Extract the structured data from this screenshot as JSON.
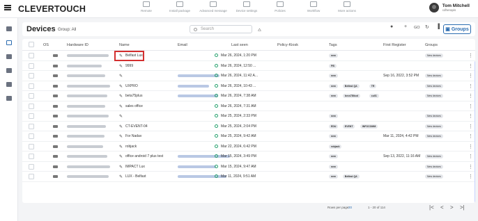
{
  "app": {
    "logo": "CLEVERTOUCH",
    "user_name": "Tom Mitchell",
    "user_org": "cdherapis"
  },
  "toolbar": [
    "Remote",
    "Install package",
    "Advanced message",
    "Device settings",
    "Policies",
    "Workflow",
    "More actions"
  ],
  "header": {
    "title": "Devices",
    "group": "Group: All",
    "search_placeholder": "Search",
    "groups_button": "Groups",
    "go": "GO"
  },
  "columns": {
    "os": "OS",
    "hardware_id": "Hardware ID",
    "name": "Name",
    "email": "Email",
    "last_seen": "Last seen",
    "policy_kiosk": "Policy-Kiosk",
    "tags": "Tags",
    "first_register": "First Register",
    "groups": "Groups"
  },
  "rows": [
    {
      "name": "Belfast Lux",
      "seen": "Mar 26, 2024, 1:20 PM",
      "tags": [
        "new"
      ],
      "first": "",
      "group": "New devices",
      "hw": 60,
      "em": 0
    },
    {
      "name": "9999",
      "seen": "Mar 26, 2024, 12:50 ...",
      "tags": [
        "PB"
      ],
      "first": "",
      "group": "",
      "hw": 50,
      "em": 0
    },
    {
      "name": "",
      "seen": "Mar 26, 2024, 11:42 A...",
      "tags": [
        "new"
      ],
      "first": "Sep 16, 2022, 3:52 PM",
      "group": "New devices",
      "hw": 55,
      "em": 60
    },
    {
      "name": "UXPRO",
      "seen": "Mar 26, 2024, 10:43 ...",
      "tags": [
        "new",
        "Belfast QA",
        "TR"
      ],
      "first": "",
      "group": "New devices",
      "hw": 62,
      "em": 45
    },
    {
      "name": "beta75plus",
      "seen": "Mar 26, 2024, 7:38 AM",
      "tags": [
        "new",
        "bvcs78lkod",
        "cull1"
      ],
      "first": "",
      "group": "New devices",
      "hw": 58,
      "em": 58
    },
    {
      "name": "sales office",
      "seen": "Mar 26, 2024, 7:31 AM",
      "tags": [],
      "first": "",
      "group": "",
      "hw": 55,
      "em": 0
    },
    {
      "name": "",
      "seen": "Mar 25, 2024, 2:33 PM",
      "tags": [
        "new"
      ],
      "first": "",
      "group": "New devices",
      "hw": 60,
      "em": 0
    },
    {
      "name": "CT-EVENT-04",
      "seen": "Mar 25, 2024, 2:04 PM",
      "tags": [
        "EDU",
        "EVENT",
        "INFOCOMM"
      ],
      "first": "",
      "group": "New devices",
      "hw": 56,
      "em": 0
    },
    {
      "name": "For Nadav",
      "seen": "Mar 25, 2024, 9:42 AM",
      "tags": [
        "new"
      ],
      "first": "Mar 11, 2024, 4:42 PM",
      "group": "New devices",
      "hw": 54,
      "em": 0
    },
    {
      "name": "robjack",
      "seen": "Mar 22, 2024, 6:42 PM",
      "tags": [
        "robjack"
      ],
      "first": "",
      "group": "",
      "hw": 52,
      "em": 0
    },
    {
      "name": "office android 7 plus test",
      "seen": "Mar 15, 2024, 3:49 PM",
      "tags": [
        "new"
      ],
      "first": "Sep 13, 2022, 11:16 AM",
      "group": "New devices",
      "hw": 58,
      "em": 75
    },
    {
      "name": "IMPACT Lux",
      "seen": "Mar 15, 2024, 9:47 AM",
      "tags": [
        "new"
      ],
      "first": "",
      "group": "New devices",
      "hw": 62,
      "em": 55
    },
    {
      "name": "LUX - Belfast",
      "seen": "Mar 11, 2024, 9:51 AM",
      "tags": [
        "new",
        "Belfast QA"
      ],
      "first": "",
      "group": "New devices",
      "hw": 60,
      "em": 70
    }
  ],
  "footer": {
    "rows_per_page_label": "Rows per page:",
    "rows_per_page": "20",
    "range": "1 - 20 of 114"
  }
}
